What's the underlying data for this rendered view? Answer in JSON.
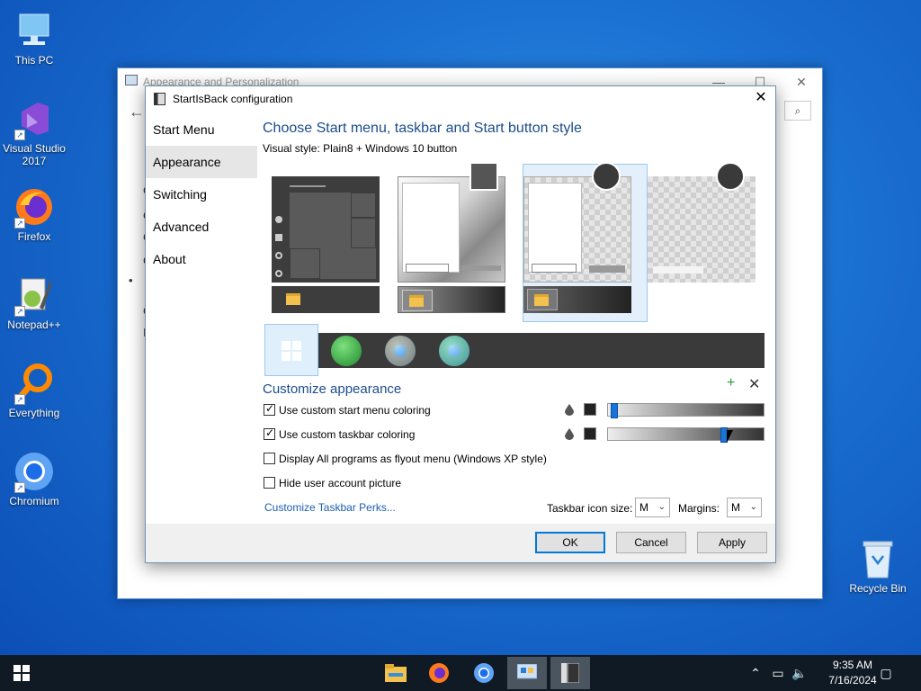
{
  "desktop": {
    "icons": [
      {
        "label": "This PC",
        "icon": "computer-icon"
      },
      {
        "label": "Visual Studio\n2017",
        "label_line1": "Visual Studio",
        "label_line2": "2017",
        "icon": "visual-studio-icon"
      },
      {
        "label": "Firefox",
        "icon": "firefox-icon"
      },
      {
        "label": "Notepad++",
        "icon": "notepadpp-icon"
      },
      {
        "label": "Everything",
        "icon": "everything-search-icon"
      },
      {
        "label": "Chromium",
        "icon": "chromium-icon"
      }
    ],
    "recycle_bin": "Recycle Bin"
  },
  "background_window": {
    "title": "Appearance and Personalization",
    "controls": {
      "minimize": "—",
      "maximize": "☐",
      "close": "✕"
    },
    "back": "←",
    "search_icon": "🔍",
    "bullet": "•"
  },
  "dialog": {
    "title": "StartIsBack configuration",
    "close": "✕",
    "nav": [
      "Start Menu",
      "Appearance",
      "Switching",
      "Advanced",
      "About"
    ],
    "nav_selected": "Appearance",
    "heading": "Choose Start menu, taskbar and Start button style",
    "visual_style": "Visual style:  Plain8 + Windows 10 button",
    "plus": "+",
    "x": "✕",
    "customize_heading": "Customize appearance",
    "options": [
      {
        "label": "Use custom start menu coloring",
        "checked": true
      },
      {
        "label": "Use custom taskbar coloring",
        "checked": true
      },
      {
        "label": "Display All programs as flyout menu (Windows XP style)",
        "checked": false
      },
      {
        "label": "Hide user account picture",
        "checked": false
      }
    ],
    "sliders": {
      "start_menu_transparency": 0.02,
      "taskbar_transparency": 0.76
    },
    "link": "Customize Taskbar Perks...",
    "taskbar_icon_size_label": "Taskbar icon size:",
    "taskbar_icon_size_value": "M",
    "margins_label": "Margins:",
    "margins_value": "M",
    "buttons": {
      "ok": "OK",
      "cancel": "Cancel",
      "apply": "Apply"
    }
  },
  "taskbar": {
    "clock_time": "9:35 AM",
    "clock_date": "7/16/2024",
    "tray_chevron": "^",
    "apps": [
      "file-explorer-icon",
      "firefox-icon",
      "chromium-icon",
      "control-panel-icon",
      "startisback-icon"
    ]
  },
  "colors": {
    "accent": "#0078d7",
    "heading_blue": "#1b4d8c",
    "link_blue": "#1a5fb4",
    "desktop_blue": "#1a6fd0",
    "taskbar": "#0f1a24"
  }
}
